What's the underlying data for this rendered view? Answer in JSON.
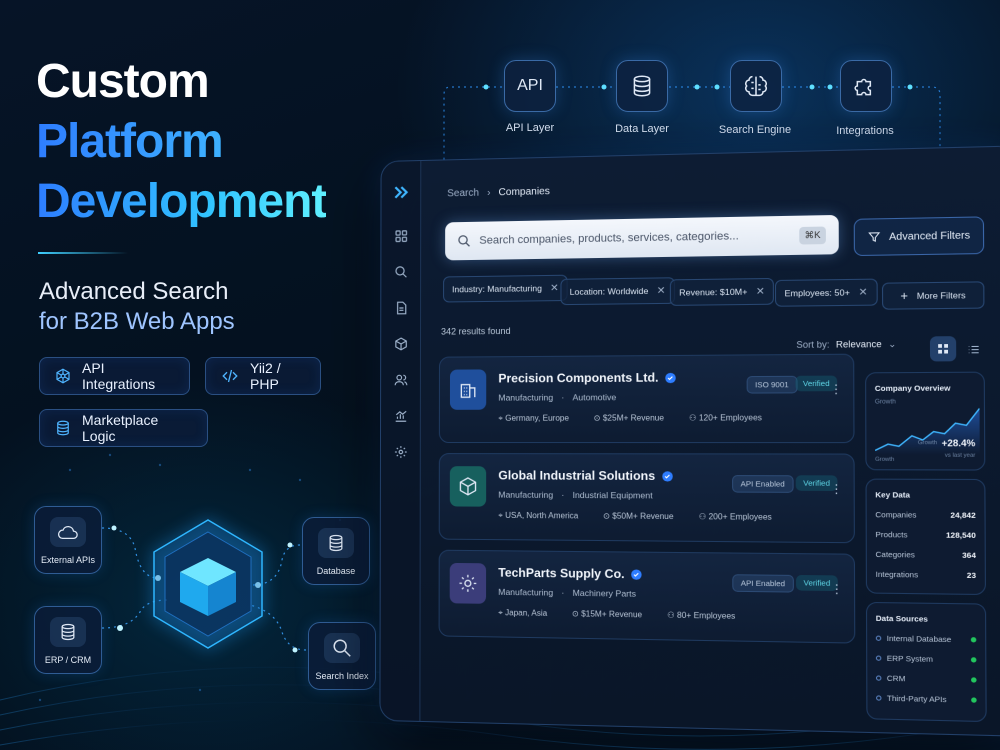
{
  "hero": {
    "title_line1": "Custom",
    "title_line2": "Platform",
    "title_line3": "Development",
    "subtitle_line1": "Advanced Search",
    "subtitle_line2": "for B2B Web Apps",
    "pills": [
      {
        "label": "API Integrations",
        "icon": "network-icon"
      },
      {
        "label": "Yii2 / PHP",
        "icon": "code-icon"
      },
      {
        "label": "Marketplace Logic",
        "icon": "database-icon"
      }
    ]
  },
  "pipeline": [
    {
      "label": "API Layer",
      "icon_text": "API"
    },
    {
      "label": "Data Layer",
      "icon": "database-icon"
    },
    {
      "label": "Search Engine",
      "icon": "brain-icon"
    },
    {
      "label": "Integrations",
      "icon": "puzzle-icon"
    }
  ],
  "graph_nodes": [
    {
      "label": "External APIs",
      "icon": "cloud-icon"
    },
    {
      "label": "Database",
      "icon": "database-icon"
    },
    {
      "label": "ERP / CRM",
      "icon": "database-icon"
    },
    {
      "label": "Search Index",
      "icon": "magnifier-icon"
    }
  ],
  "app": {
    "breadcrumb": {
      "root": "Search",
      "current": "Companies"
    },
    "search": {
      "placeholder": "Search companies, products, services, categories...",
      "shortcut": "⌘K"
    },
    "advanced_filters_label": "Advanced Filters",
    "filters": [
      "Industry: Manufacturing",
      "Location: Worldwide",
      "Revenue: $10M+",
      "Employees: 50+"
    ],
    "more_filters_label": "More Filters",
    "results_count": "342 results found",
    "sort": {
      "label": "Sort by:",
      "value": "Relevance"
    },
    "companies": [
      {
        "name": "Precision Components Ltd.",
        "industry": "Manufacturing",
        "sub": "Automotive",
        "location": "Germany, Europe",
        "revenue": "$25M+ Revenue",
        "employees": "120+ Employees",
        "badge1": "ISO 9001",
        "badge2": "Verified"
      },
      {
        "name": "Global Industrial Solutions",
        "industry": "Manufacturing",
        "sub": "Industrial Equipment",
        "location": "USA, North America",
        "revenue": "$50M+ Revenue",
        "employees": "200+ Employees",
        "badge1": "API Enabled",
        "badge2": "Verified"
      },
      {
        "name": "TechParts Supply Co.",
        "industry": "Manufacturing",
        "sub": "Machinery Parts",
        "location": "Japan, Asia",
        "revenue": "$15M+ Revenue",
        "employees": "80+ Employees",
        "badge1": "API Enabled",
        "badge2": "Verified"
      }
    ],
    "overview": {
      "title": "Company Overview",
      "label_top": "Growth",
      "label_bottom": "Growth",
      "growth_label": "Growth",
      "growth_value": "+28.4%",
      "growth_sub": "vs last year"
    },
    "key_data": {
      "title": "Key Data",
      "rows": [
        {
          "label": "Companies",
          "value": "24,842"
        },
        {
          "label": "Products",
          "value": "128,540"
        },
        {
          "label": "Categories",
          "value": "364"
        },
        {
          "label": "Integrations",
          "value": "23"
        }
      ]
    },
    "data_sources": {
      "title": "Data Sources",
      "items": [
        "Internal Database",
        "ERP System",
        "CRM",
        "Third-Party APIs"
      ]
    }
  },
  "colors": {
    "accent": "#3fb6ff",
    "verified": "#5fd6e6",
    "status_ok": "#22c55e"
  }
}
